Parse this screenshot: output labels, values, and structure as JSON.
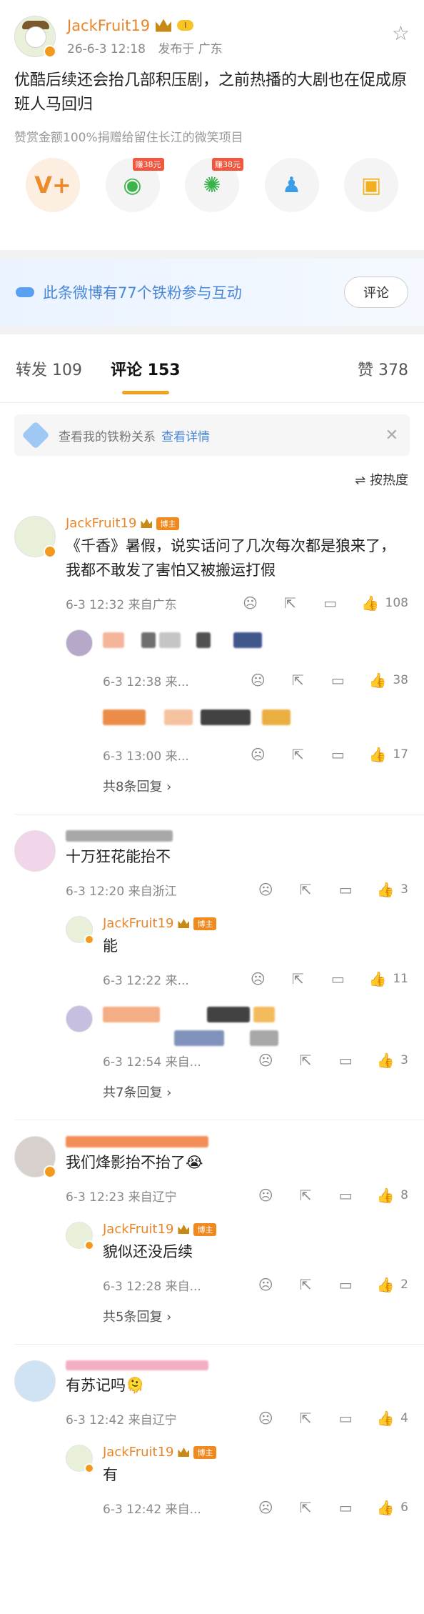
{
  "post": {
    "author": "JackFruit19",
    "level_badge": "I",
    "time": "26-6-3 12:18",
    "location": "发布于 广东",
    "text": "优酷后续还会抬几部积压剧，之前热播的大剧也在促成原班人马回归",
    "donate_note": "赞赏金额100%捐赠给留住长江的微笑项目",
    "share_actions": [
      {
        "icon": "v-plus-icon",
        "earn": ""
      },
      {
        "icon": "wechat-icon",
        "earn": "赚38元"
      },
      {
        "icon": "moments-icon",
        "earn": "赚38元"
      },
      {
        "icon": "qq-icon",
        "earn": ""
      },
      {
        "icon": "qzone-icon",
        "earn": ""
      }
    ]
  },
  "fans_bar": {
    "text": "此条微博有77个铁粉参与互动",
    "button": "评论"
  },
  "tabs": {
    "repost": "转发 109",
    "comment": "评论 153",
    "like": "赞 378"
  },
  "relation_bar": {
    "text": "查看我的铁粉关系",
    "link": "查看详情"
  },
  "sort_label": "按热度",
  "comments": [
    {
      "name": "JackFruit19",
      "is_host": true,
      "host_tag": "博主",
      "text": "《千香》暑假，说实话问了几次每次都是狼来了，我都不敢发了害怕又被搬运打假",
      "time": "6-3 12:32 来自广东",
      "likes": "108",
      "replies": [
        {
          "name": "",
          "text": "",
          "time": "6-3 12:38 来...",
          "likes": "38",
          "blurred": true
        },
        {
          "name": "",
          "text": "",
          "time": "6-3 13:00 来...",
          "likes": "17",
          "blurred": true
        }
      ],
      "more": "共8条回复 ›"
    },
    {
      "name": "",
      "is_host": false,
      "text": "十万狂花能抬不",
      "time": "6-3 12:20 来自浙江",
      "likes": "3",
      "replies": [
        {
          "name": "JackFruit19",
          "host_tag": "博主",
          "text": "能",
          "time": "6-3 12:22 来...",
          "likes": "11",
          "blurred": false
        },
        {
          "name": "",
          "text": "",
          "time": "6-3 12:54 来自...",
          "likes": "3",
          "blurred": true
        }
      ],
      "more": "共7条回复 ›"
    },
    {
      "name": "",
      "is_host": false,
      "text": "我们烽影抬不抬了😭",
      "time": "6-3 12:23 来自辽宁",
      "likes": "8",
      "replies": [
        {
          "name": "JackFruit19",
          "host_tag": "博主",
          "text": "貌似还没后续",
          "time": "6-3 12:28 来自...",
          "likes": "2",
          "blurred": false
        }
      ],
      "more": "共5条回复 ›"
    },
    {
      "name": "",
      "is_host": false,
      "text": "有苏记吗🫠",
      "time": "6-3 12:42 来自辽宁",
      "likes": "4",
      "replies": [
        {
          "name": "JackFruit19",
          "host_tag": "博主",
          "text": "有",
          "time": "6-3 12:42 来自...",
          "likes": "6",
          "blurred": false
        }
      ],
      "more": ""
    }
  ]
}
